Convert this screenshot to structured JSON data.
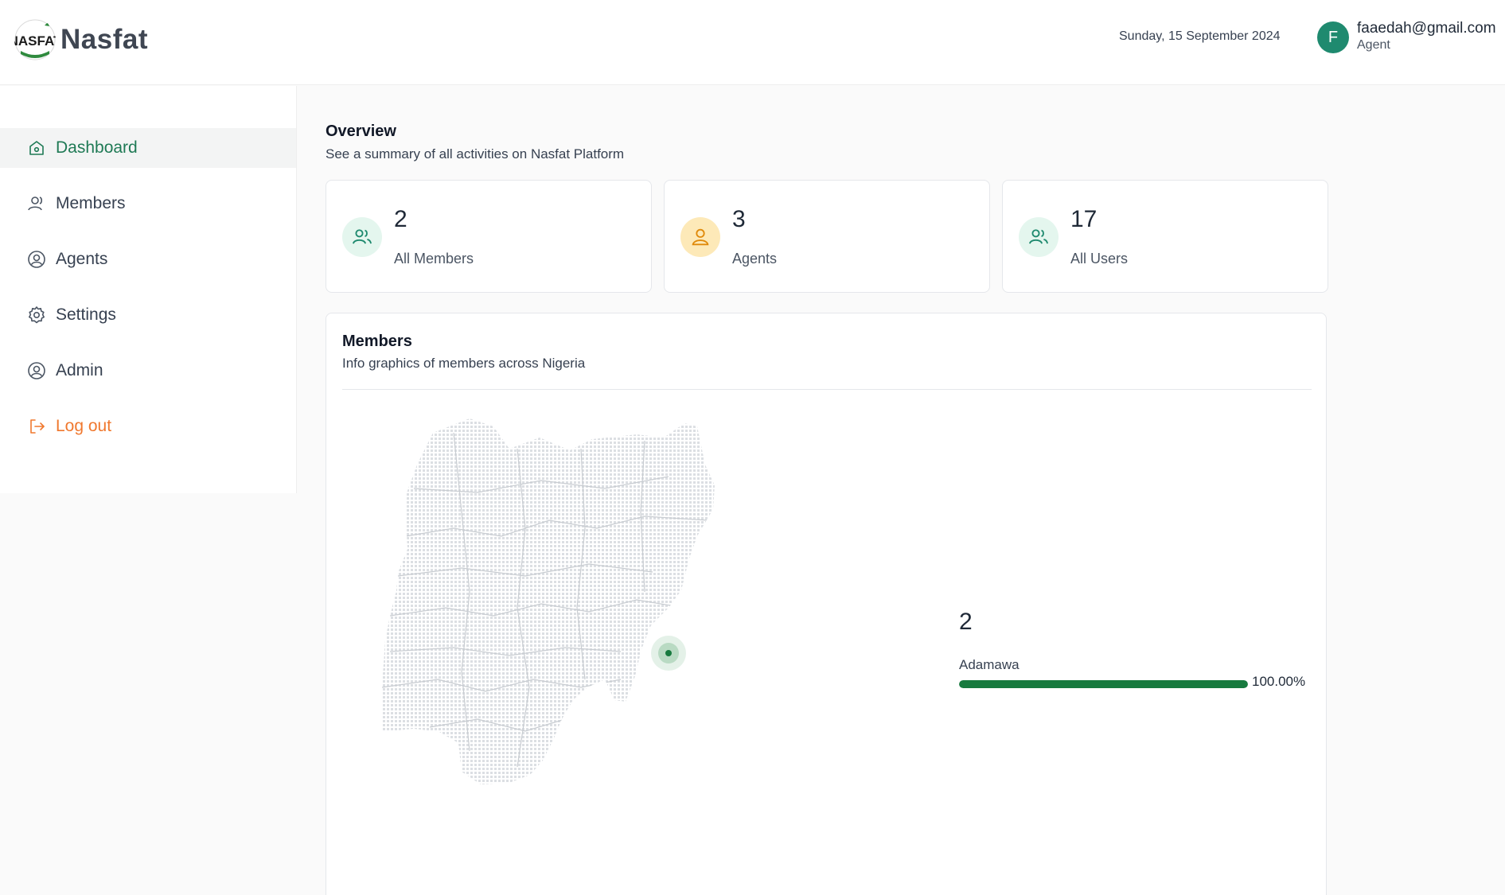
{
  "header": {
    "logo_text": "Nasfat",
    "logo_badge_text": "NASFAT",
    "date": "Sunday, 15 September 2024",
    "user": {
      "initial": "F",
      "email": "faaedah@gmail.com",
      "role": "Agent"
    }
  },
  "sidebar": {
    "items": [
      {
        "label": "Dashboard",
        "icon": "home-icon",
        "active": true
      },
      {
        "label": "Members",
        "icon": "user-icon"
      },
      {
        "label": "Agents",
        "icon": "user-circle-icon"
      },
      {
        "label": "Settings",
        "icon": "gear-icon"
      },
      {
        "label": "Admin",
        "icon": "user-circle-icon"
      },
      {
        "label": "Log out",
        "icon": "logout-icon"
      }
    ]
  },
  "overview": {
    "title": "Overview",
    "subtitle": "See a summary of all activities on Nasfat Platform"
  },
  "stats": [
    {
      "value": "2",
      "label": "All Members",
      "icon": "users-icon",
      "color": "#1f8a6f"
    },
    {
      "value": "3",
      "label": "Agents",
      "icon": "user-icon",
      "color": "#e08a0b"
    },
    {
      "value": "17",
      "label": "All Users",
      "icon": "users-icon",
      "color": "#1f8a6f"
    }
  ],
  "members_panel": {
    "title": "Members",
    "subtitle": "Info graphics of members across Nigeria",
    "states": [
      {
        "count": "2",
        "name": "Adamawa",
        "percent_label": "100.00%",
        "percent": 100
      }
    ]
  },
  "colors": {
    "accent_green": "#1f7a55",
    "bar_green": "#177a3e",
    "logout_orange": "#f0782e"
  }
}
